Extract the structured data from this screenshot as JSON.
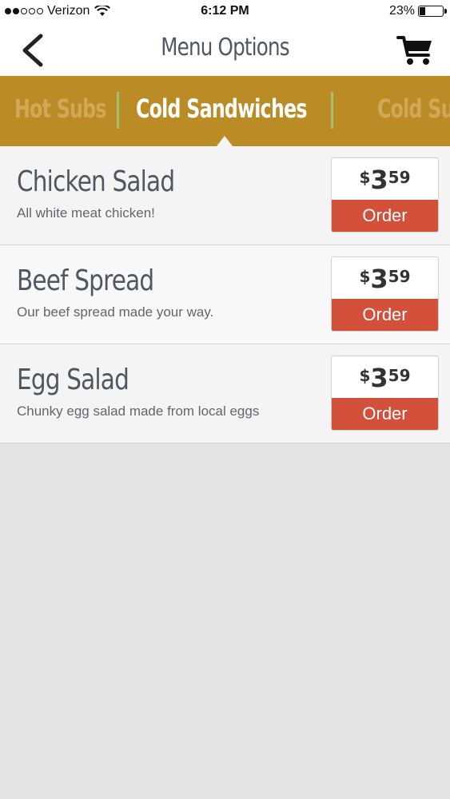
{
  "status_bar": {
    "carrier": "Verizon",
    "time": "6:12 PM",
    "battery": "23%",
    "battery_level": 0.23,
    "signal_bars_filled": 2,
    "signal_bars_total": 5
  },
  "nav": {
    "title": "Menu Options",
    "back_icon": "chevron-left-icon",
    "cart_icon": "cart-icon"
  },
  "categories": {
    "items": [
      "Hot Subs",
      "Cold Sandwiches",
      "Cold Subs"
    ],
    "active": "Cold Sandwiches"
  },
  "menu_items": [
    {
      "name": "Chicken Salad",
      "description": "All white meat chicken!",
      "price_symbol": "$",
      "price_dollars": "3",
      "price_cents": "59",
      "order_label": "Order"
    },
    {
      "name": "Beef Spread",
      "description": "Our beef spread made your way.",
      "price_symbol": "$",
      "price_dollars": "3",
      "price_cents": "59",
      "order_label": "Order"
    },
    {
      "name": "Egg Salad",
      "description": "Chunky egg salad made from local eggs",
      "price_symbol": "$",
      "price_dollars": "3",
      "price_cents": "59",
      "order_label": "Order"
    }
  ],
  "colors": {
    "category_bar": "#bb8b25",
    "order_button": "#d3503a",
    "title_text": "#4d5862",
    "divider": "#9fc273"
  }
}
